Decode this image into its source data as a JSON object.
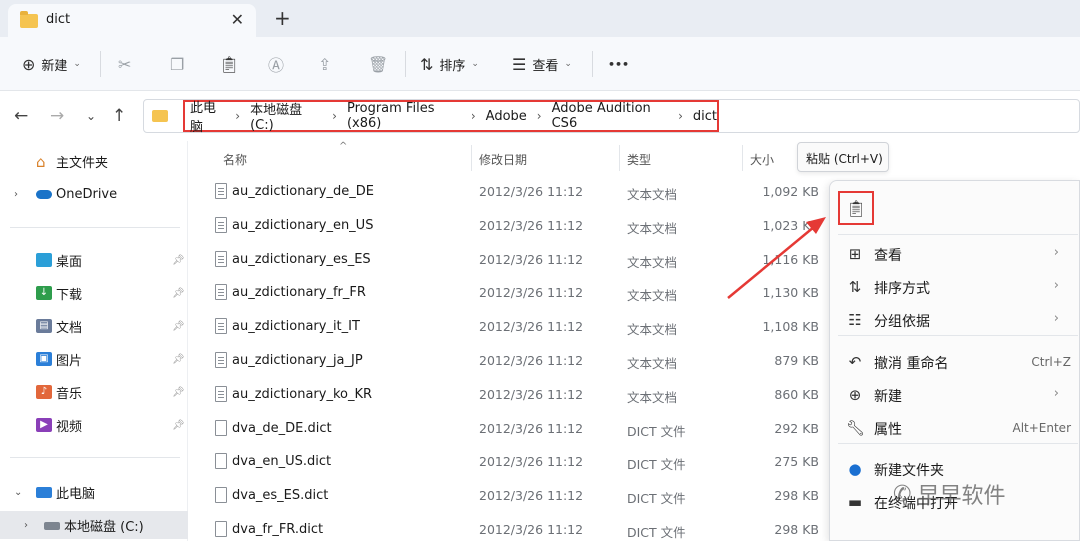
{
  "tab": {
    "title": "dict",
    "close": "✕",
    "new_tab": "+"
  },
  "toolbar": {
    "new_label": "新建",
    "sort_label": "排序",
    "view_label": "查看",
    "more": "•••"
  },
  "address": {
    "crumbs": [
      "此电脑",
      "本地磁盘 (C:)",
      "Program Files (x86)",
      "Adobe",
      "Adobe Audition CS6",
      "dict"
    ],
    "separator": "›"
  },
  "sidebar": {
    "home": "主文件夹",
    "onedrive": "OneDrive",
    "quick": [
      {
        "label": "桌面",
        "icon": "desktop-icon",
        "color": "#2b9fd8"
      },
      {
        "label": "下载",
        "icon": "download-icon",
        "color": "#2e9d4c"
      },
      {
        "label": "文档",
        "icon": "document-icon",
        "color": "#6a7b9a"
      },
      {
        "label": "图片",
        "icon": "pictures-icon",
        "color": "#2b7fd8"
      },
      {
        "label": "音乐",
        "icon": "music-icon",
        "color": "#e2673b"
      },
      {
        "label": "视频",
        "icon": "video-icon",
        "color": "#8a3fb8"
      }
    ],
    "this_pc": "此电脑",
    "local_disk": "本地磁盘 (C:)"
  },
  "columns": {
    "name": "名称",
    "date": "修改日期",
    "type": "类型",
    "size": "大小"
  },
  "files": [
    {
      "name": "au_zdictionary_de_DE",
      "date": "2012/3/26 11:12",
      "type": "文本文档",
      "size": "1,092 KB",
      "icon": "text"
    },
    {
      "name": "au_zdictionary_en_US",
      "date": "2012/3/26 11:12",
      "type": "文本文档",
      "size": "1,023 KB",
      "icon": "text"
    },
    {
      "name": "au_zdictionary_es_ES",
      "date": "2012/3/26 11:12",
      "type": "文本文档",
      "size": "1,116 KB",
      "icon": "text"
    },
    {
      "name": "au_zdictionary_fr_FR",
      "date": "2012/3/26 11:12",
      "type": "文本文档",
      "size": "1,130 KB",
      "icon": "text"
    },
    {
      "name": "au_zdictionary_it_IT",
      "date": "2012/3/26 11:12",
      "type": "文本文档",
      "size": "1,108 KB",
      "icon": "text"
    },
    {
      "name": "au_zdictionary_ja_JP",
      "date": "2012/3/26 11:12",
      "type": "文本文档",
      "size": "879 KB",
      "icon": "text"
    },
    {
      "name": "au_zdictionary_ko_KR",
      "date": "2012/3/26 11:12",
      "type": "文本文档",
      "size": "860 KB",
      "icon": "text"
    },
    {
      "name": "dva_de_DE.dict",
      "date": "2012/3/26 11:12",
      "type": "DICT 文件",
      "size": "292 KB",
      "icon": "plain"
    },
    {
      "name": "dva_en_US.dict",
      "date": "2012/3/26 11:12",
      "type": "DICT 文件",
      "size": "275 KB",
      "icon": "plain"
    },
    {
      "name": "dva_es_ES.dict",
      "date": "2012/3/26 11:12",
      "type": "DICT 文件",
      "size": "298 KB",
      "icon": "plain"
    },
    {
      "name": "dva_fr_FR.dict",
      "date": "2012/3/26 11:12",
      "type": "DICT 文件",
      "size": "298 KB",
      "icon": "plain"
    }
  ],
  "tooltip": "粘贴 (Ctrl+V)",
  "menu": {
    "items": [
      {
        "label": "查看",
        "icon": "grid-icon",
        "shortcut": "",
        "chevron": "›"
      },
      {
        "label": "排序方式",
        "icon": "sort-icon",
        "shortcut": "",
        "chevron": "›"
      },
      {
        "label": "分组依据",
        "icon": "group-icon",
        "shortcut": "",
        "chevron": "›"
      },
      {
        "label": "撤消 重命名",
        "icon": "undo-icon",
        "shortcut": "Ctrl+Z",
        "chevron": ""
      },
      {
        "label": "新建",
        "icon": "plus-circle-icon",
        "shortcut": "",
        "chevron": "›"
      },
      {
        "label": "属性",
        "icon": "wrench-icon",
        "shortcut": "Alt+Enter",
        "chevron": ""
      },
      {
        "label": "新建文件夹",
        "icon": "new-folder-icon",
        "shortcut": "",
        "chevron": ""
      },
      {
        "label": "在终端中打开",
        "icon": "terminal-icon",
        "shortcut": "",
        "chevron": ""
      }
    ]
  },
  "watermark": "早早软件",
  "colors": {
    "highlight": "#e53935",
    "accent": "#0067c0"
  }
}
